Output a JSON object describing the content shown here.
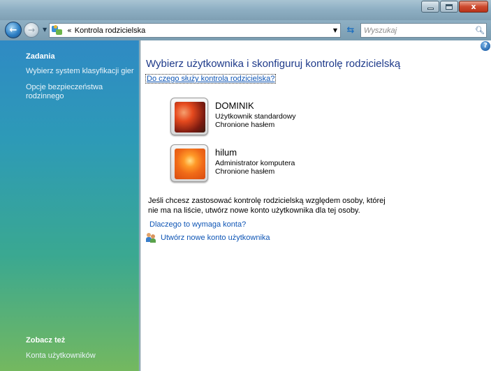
{
  "window": {
    "close_label": "x"
  },
  "address": {
    "chevron": "«",
    "path": "Kontrola rodzicielska"
  },
  "search": {
    "placeholder": "Wyszukaj"
  },
  "taskpane": {
    "tasks_heading": "Zadania",
    "links": [
      "Wybierz system klasyfikacji gier",
      "Opcje bezpieczeństwa",
      "rodzinnego"
    ],
    "see_also_heading": "Zobacz też",
    "see_also_link": "Konta użytkowników"
  },
  "main": {
    "title": "Wybierz użytkownika i skonfiguruj kontrolę rodzicielską",
    "help_link": "Do czego służy kontrola rodzicielska?",
    "users": [
      {
        "name": "DOMINIK",
        "role": "Użytkownik standardowy",
        "protection": "Chronione hasłem"
      },
      {
        "name": "hilum",
        "role": "Administrator komputera",
        "protection": "Chronione hasłem"
      }
    ],
    "info_line1": "Jeśli chcesz zastosować kontrolę rodzicielską względem osoby, której",
    "info_line2": "nie ma na liście, utwórz nowe konto użytkownika dla tej osoby.",
    "why_link": "Dlaczego to wymaga konta?",
    "create_link": "Utwórz nowe konto użytkownika"
  },
  "icons": {
    "back": "back-arrow-icon",
    "forward": "forward-arrow-icon",
    "refresh": "refresh-icon",
    "search": "search-icon",
    "help": "help-icon",
    "users": "users-icon"
  }
}
